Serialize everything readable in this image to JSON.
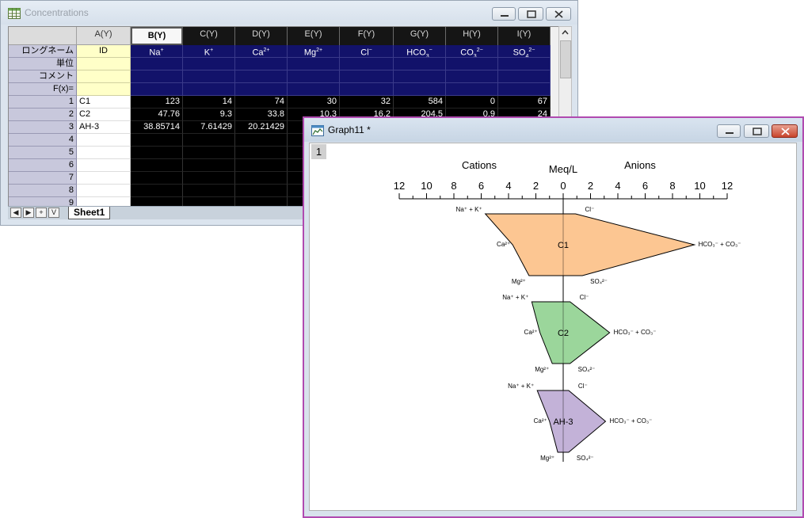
{
  "worksheet": {
    "title": "Concentrations",
    "icon": "worksheet-icon",
    "row_labels": [
      "ロングネーム",
      "単位",
      "コメント",
      "F(x)="
    ],
    "columns": [
      {
        "name": "A(Y)",
        "long_name": "ID"
      },
      {
        "name": "B(Y)",
        "long_name": "Na+",
        "ln_base": "Na",
        "ln_sup": "+",
        "ln_sub": ""
      },
      {
        "name": "C(Y)",
        "long_name": "K+",
        "ln_base": "K",
        "ln_sup": "+",
        "ln_sub": ""
      },
      {
        "name": "D(Y)",
        "long_name": "Ca2+",
        "ln_base": "Ca",
        "ln_sup": "2+",
        "ln_sub": ""
      },
      {
        "name": "E(Y)",
        "long_name": "Mg2+",
        "ln_base": "Mg",
        "ln_sup": "2+",
        "ln_sub": ""
      },
      {
        "name": "F(Y)",
        "long_name": "Cl-",
        "ln_base": "Cl",
        "ln_sup": "−",
        "ln_sub": ""
      },
      {
        "name": "G(Y)",
        "long_name": "HCO3-",
        "ln_base": "HCO",
        "ln_sup": "−",
        "ln_sub": "3"
      },
      {
        "name": "H(Y)",
        "long_name": "CO3 2-",
        "ln_base": "CO",
        "ln_sup": "2−",
        "ln_sub": "3"
      },
      {
        "name": "I(Y)",
        "long_name": "SO4 2-",
        "ln_base": "SO",
        "ln_sup": "2−",
        "ln_sub": "4"
      }
    ],
    "rows": [
      {
        "num": "1",
        "cells": [
          "C1",
          "123",
          "14",
          "74",
          "30",
          "32",
          "584",
          "0",
          "67"
        ]
      },
      {
        "num": "2",
        "cells": [
          "C2",
          "47.76",
          "9.3",
          "33.8",
          "10.3",
          "16.2",
          "204.5",
          "0.9",
          "24"
        ]
      },
      {
        "num": "3",
        "cells": [
          "AH-3",
          "38.85714",
          "7.61429",
          "20.21429",
          "",
          "",
          "",
          "",
          ""
        ]
      },
      {
        "num": "4",
        "cells": [
          "",
          "",
          "",
          "",
          "",
          "",
          "",
          "",
          ""
        ]
      },
      {
        "num": "5",
        "cells": [
          "",
          "",
          "",
          "",
          "",
          "",
          "",
          "",
          ""
        ]
      },
      {
        "num": "6",
        "cells": [
          "",
          "",
          "",
          "",
          "",
          "",
          "",
          "",
          ""
        ]
      },
      {
        "num": "7",
        "cells": [
          "",
          "",
          "",
          "",
          "",
          "",
          "",
          "",
          ""
        ]
      },
      {
        "num": "8",
        "cells": [
          "",
          "",
          "",
          "",
          "",
          "",
          "",
          "",
          ""
        ]
      },
      {
        "num": "9",
        "cells": [
          "",
          "",
          "",
          "",
          "",
          "",
          "",
          "",
          ""
        ]
      }
    ],
    "sheet_nav": [
      "◀",
      "▶",
      "+",
      "V"
    ],
    "sheet_tab": "Sheet1"
  },
  "graph": {
    "title": "Graph11 *",
    "icon": "graph-icon",
    "layer_label": "1",
    "colors": {
      "C1": "#fcc692",
      "C2": "#9bd69b",
      "AH-3": "#c3b2d8"
    },
    "chart_data": {
      "type": "stiff-diagram",
      "header_left": "Cations",
      "header_center": "Meq/L",
      "header_right": "Anions",
      "axis_ticks": [
        "12",
        "10",
        "8",
        "6",
        "4",
        "2",
        "0",
        "2",
        "4",
        "6",
        "8",
        "10",
        "12"
      ],
      "xlim": [
        -12,
        12
      ],
      "samples": [
        {
          "id": "C1",
          "cations": {
            "Na+K": 5.7,
            "Ca": 3.7,
            "Mg": 2.5
          },
          "anions": {
            "Cl": 0.9,
            "HCO3+CO3": 9.6,
            "SO4": 1.4
          }
        },
        {
          "id": "C2",
          "cations": {
            "Na+K": 2.3,
            "Ca": 1.7,
            "Mg": 0.8
          },
          "anions": {
            "Cl": 0.5,
            "HCO3+CO3": 3.4,
            "SO4": 0.5
          }
        },
        {
          "id": "AH-3",
          "cations": {
            "Na+K": 1.9,
            "Ca": 1.0,
            "Mg": 0.4
          },
          "anions": {
            "Cl": 0.4,
            "HCO3+CO3": 3.1,
            "SO4": 0.4
          }
        }
      ],
      "ion_labels": {
        "NaK": "Na⁺ + K⁺",
        "Ca": "Ca²⁺",
        "Mg": "Mg²⁺",
        "Cl": "Cl⁻",
        "HCO3": "HCO₃⁻ + CO₃⁻",
        "SO4": "SO₄²⁻"
      }
    }
  }
}
